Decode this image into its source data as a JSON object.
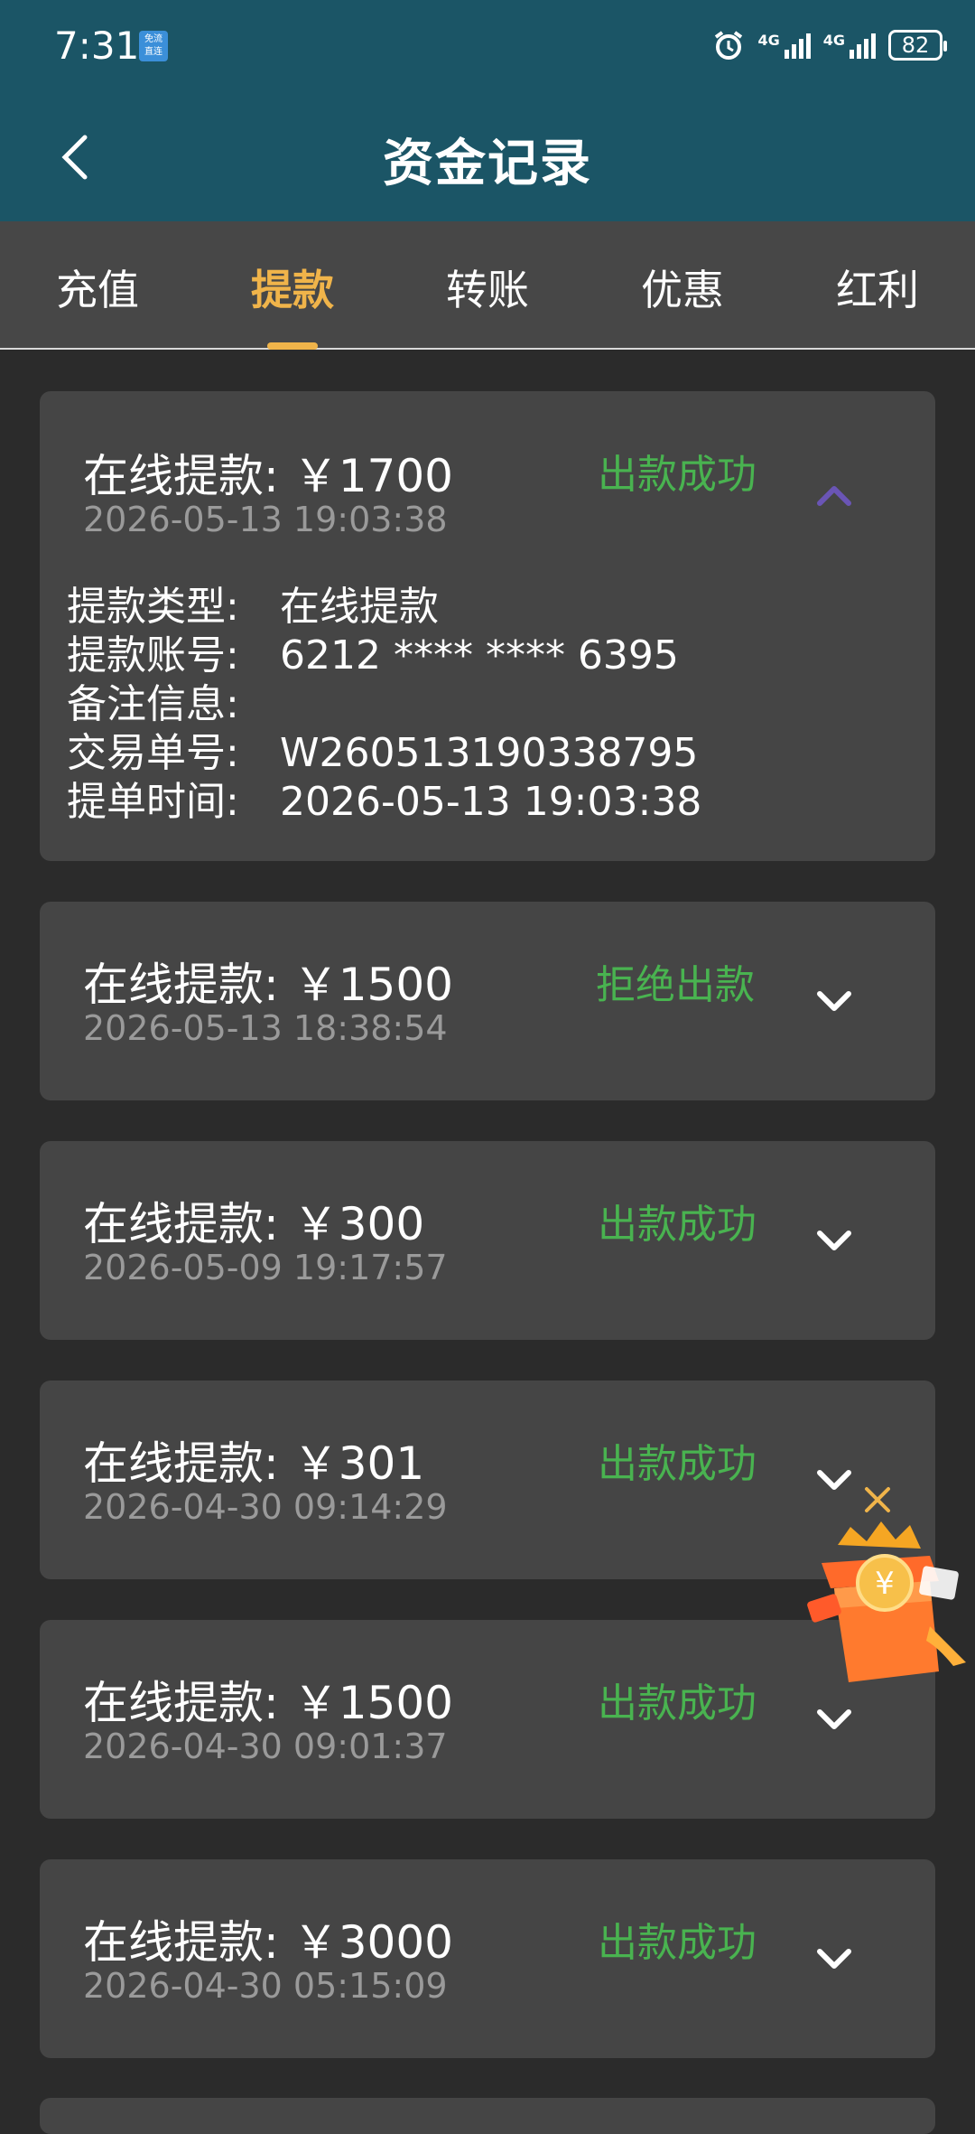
{
  "status_bar": {
    "time": "7:31",
    "mini_badge": "免流 直连",
    "network1": "4G",
    "network2": "4G",
    "battery": "82"
  },
  "header": {
    "title": "资金记录"
  },
  "tabs": [
    {
      "label": "充值"
    },
    {
      "label": "提款"
    },
    {
      "label": "转账"
    },
    {
      "label": "优惠"
    },
    {
      "label": "红利"
    }
  ],
  "records": [
    {
      "title": "在线提款: ￥1700",
      "date": "2026-05-13 19:03:38",
      "status": "出款成功",
      "expanded": true,
      "details": [
        {
          "label": "提款类型:",
          "value": "在线提款"
        },
        {
          "label": "提款账号:",
          "value": "6212 **** **** 6395"
        },
        {
          "label": "备注信息:",
          "value": ""
        },
        {
          "label": "交易单号:",
          "value": "W260513190338795"
        },
        {
          "label": "提单时间:",
          "value": "2026-05-13 19:03:38"
        }
      ]
    },
    {
      "title": "在线提款: ￥1500",
      "date": "2026-05-13 18:38:54",
      "status": "拒绝出款",
      "expanded": false
    },
    {
      "title": "在线提款: ￥300",
      "date": "2026-05-09 19:17:57",
      "status": "出款成功",
      "expanded": false
    },
    {
      "title": "在线提款: ￥301",
      "date": "2026-04-30 09:14:29",
      "status": "出款成功",
      "expanded": false
    },
    {
      "title": "在线提款: ￥1500",
      "date": "2026-04-30 09:01:37",
      "status": "出款成功",
      "expanded": false
    },
    {
      "title": "在线提款: ￥3000",
      "date": "2026-04-30 05:15:09",
      "status": "出款成功",
      "expanded": false
    }
  ],
  "colors": {
    "header_bg": "#1b5566",
    "tab_bg": "#474747",
    "active_tab": "#f0b44a",
    "card_bg": "#454545",
    "status_green": "#49b350",
    "page_bg": "#2b2b2b"
  },
  "icons": {
    "back": "chevron-left-icon",
    "collapse": "chevron-up-icon",
    "expand": "chevron-down-icon",
    "promo": "gift-box-icon",
    "promo_close": "close-icon"
  }
}
